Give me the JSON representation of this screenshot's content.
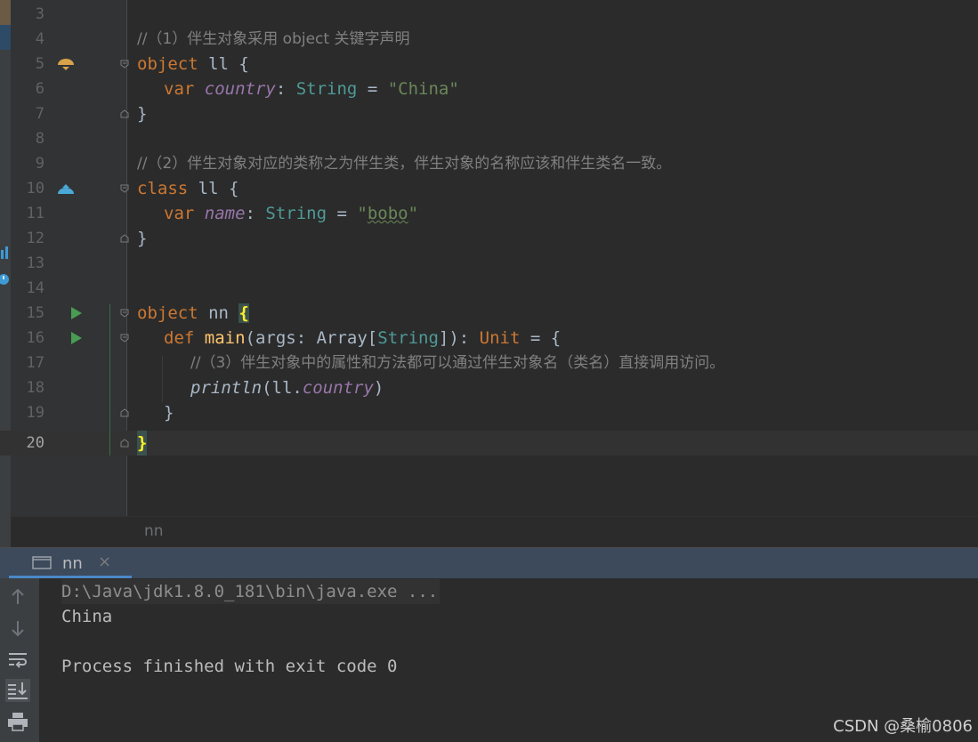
{
  "editor": {
    "lines": [
      {
        "num": "3"
      },
      {
        "num": "4"
      },
      {
        "num": "5"
      },
      {
        "num": "6"
      },
      {
        "num": "7"
      },
      {
        "num": "8"
      },
      {
        "num": "9"
      },
      {
        "num": "10"
      },
      {
        "num": "11"
      },
      {
        "num": "12"
      },
      {
        "num": "13"
      },
      {
        "num": "14"
      },
      {
        "num": "15"
      },
      {
        "num": "16"
      },
      {
        "num": "17"
      },
      {
        "num": "18"
      },
      {
        "num": "19"
      },
      {
        "num": "20"
      }
    ],
    "code": {
      "l4_comment": "//（1）伴生对象采用 object 关键字声明",
      "l5_kw": "object",
      "l5_rest": " ll {",
      "l6_kw": "var ",
      "l6_field": "country",
      "l6_colon": ": ",
      "l6_type": "String",
      "l6_eq": " = ",
      "l6_str": "\"China\"",
      "l7": "}",
      "l9_comment": "//（2）伴生对象对应的类称之为伴生类，伴生对象的名称应该和伴生类名一致。",
      "l10_kw": "class",
      "l10_rest": " ll {",
      "l11_kw": "var ",
      "l11_field": "name",
      "l11_colon": ": ",
      "l11_type": "String",
      "l11_eq": " = ",
      "l11_q1": "\"",
      "l11_str": "bobo",
      "l11_q2": "\"",
      "l12": "}",
      "l15_kw": "object",
      "l15_rest": " nn ",
      "l15_brace": "{",
      "l16_kw": "def ",
      "l16_fn": "main",
      "l16_a": "(args: Array[",
      "l16_type": "String",
      "l16_b": "]): ",
      "l16_unit": "Unit",
      "l16_c": " = {",
      "l17_comment": "//（3）伴生对象中的属性和方法都可以通过伴生对象名（类名）直接调用访问。",
      "l18_fn": "println",
      "l18_a": "(ll.",
      "l18_field": "country",
      "l18_b": ")",
      "l19": "}",
      "l20": "}"
    }
  },
  "breadcrumb": "nn",
  "run_tab": {
    "label": "nn",
    "close": "×"
  },
  "console": {
    "cmd": "D:\\Java\\jdk1.8.0_181\\bin\\java.exe ...",
    "out1": "China",
    "out2": "Process finished with exit code 0"
  },
  "watermark": "CSDN @桑榆0806",
  "colors": {
    "keyword": "#cc7832",
    "string": "#6a8759",
    "type": "#4e9a97",
    "comment": "#808080",
    "field": "#9876aa"
  }
}
